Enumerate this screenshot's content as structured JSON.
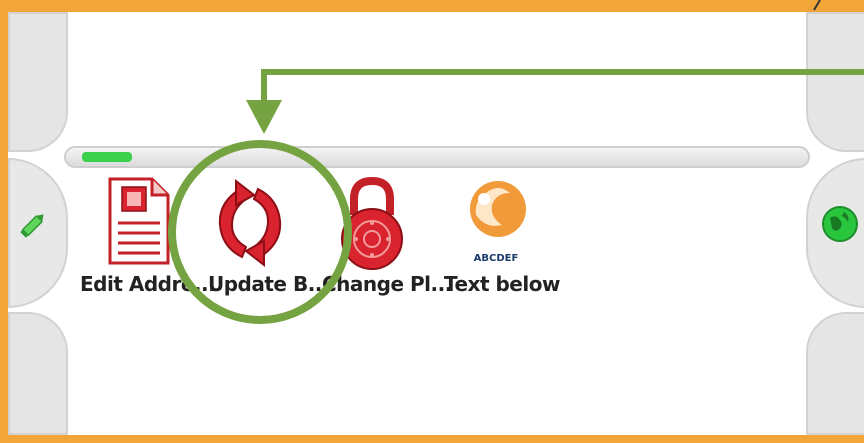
{
  "apps": [
    {
      "label": "Edit Addre...",
      "icon": "edit-address-icon"
    },
    {
      "label": "Update B...",
      "icon": "update-refresh-icon"
    },
    {
      "label": "Change Pl...",
      "icon": "change-pin-lock-icon"
    },
    {
      "label": "Text below",
      "icon": "text-below-logo-icon",
      "logo_text": "ABCDEF"
    }
  ],
  "progress": {
    "percent": 7,
    "color": "#3bd14a"
  },
  "colors": {
    "border": "#f2a63a",
    "annotation": "#76a341",
    "accent_red": "#d9232e",
    "green": "#3bd14a"
  },
  "side_icons": {
    "left": "pencil-icon",
    "right": "globe-icon"
  }
}
